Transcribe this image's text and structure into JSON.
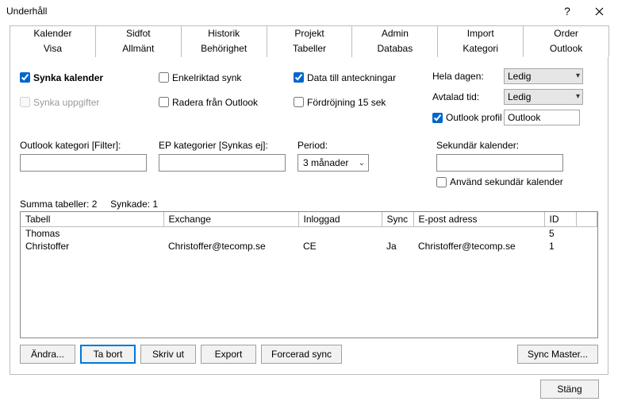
{
  "window": {
    "title": "Underhåll"
  },
  "tabs_row1": [
    "Kalender",
    "Sidfot",
    "Historik",
    "Projekt",
    "Admin",
    "Import",
    "Order"
  ],
  "tabs_row2": [
    "Visa",
    "Allmänt",
    "Behörighet",
    "Tabeller",
    "Databas",
    "Kategori",
    "Outlook"
  ],
  "active_tab": "Outlook",
  "checks": {
    "sync_calendar": "Synka kalender",
    "sync_tasks": "Synka uppgifter",
    "one_way": "Enkelriktad synk",
    "delete_from": "Radera från Outlook",
    "data_to_notes": "Data till anteckningar",
    "delay": "Fördröjning 15 sek",
    "outlook_profile": "Outlook profil",
    "use_secondary": "Använd sekundär kalender"
  },
  "right_labels": {
    "whole_day": "Hela dagen:",
    "agreed_time": "Avtalad tid:"
  },
  "combos": {
    "whole_day": "Ledig",
    "agreed_time": "Ledig",
    "period": "3 månader"
  },
  "profile_value": "Outlook",
  "filter_labels": {
    "outlook_cat": "Outlook kategori [Filter]:",
    "ep_cat": "EP kategorier [Synkas ej]:",
    "period": "Period:",
    "secondary": "Sekundär kalender:"
  },
  "status": {
    "sum": "Summa tabeller: 2",
    "synced": "Synkade: 1"
  },
  "columns": [
    "Tabell",
    "Exchange",
    "Inloggad",
    "Sync",
    "E-post adress",
    "ID",
    ""
  ],
  "rows": [
    {
      "tabell": "Thomas",
      "exchange": "",
      "inloggad": "",
      "sync": "",
      "epost": "",
      "id": "5"
    },
    {
      "tabell": "Christoffer",
      "exchange": "Christoffer@tecomp.se",
      "inloggad": "CE",
      "sync": "Ja",
      "epost": "Christoffer@tecomp.se",
      "id": "1"
    }
  ],
  "buttons": {
    "edit": "Ändra...",
    "delete": "Ta bort",
    "print": "Skriv ut",
    "export": "Export",
    "force": "Forcerad sync",
    "syncmaster": "Sync Master...",
    "close": "Stäng"
  }
}
